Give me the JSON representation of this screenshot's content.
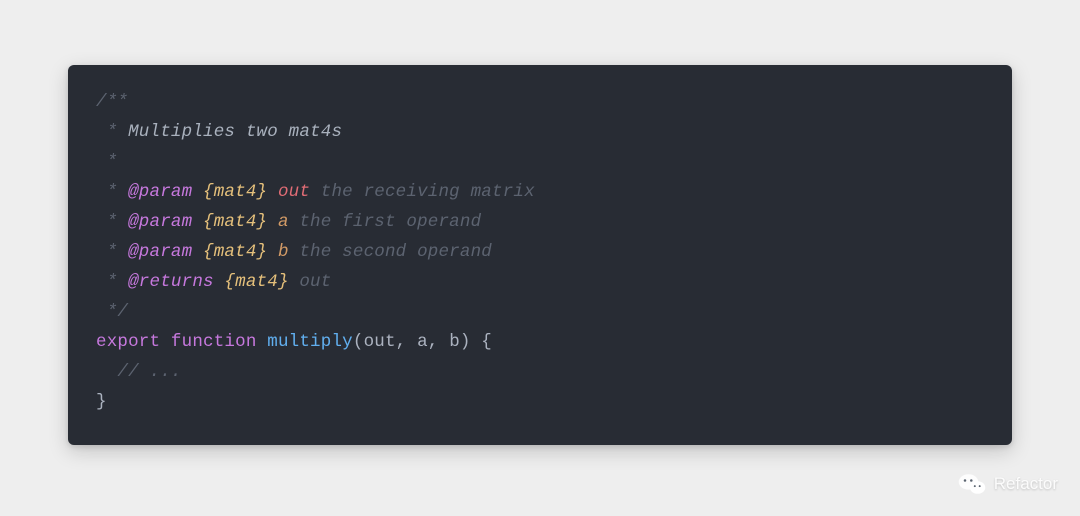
{
  "code": {
    "l1_open": "/**",
    "l2_star": " *",
    "l2_text": " Multiplies two mat4s",
    "l3_star": " *",
    "l4_star": " * ",
    "l4_tag": "@param",
    "l4_type": " {mat4}",
    "l4_name": " out",
    "l4_desc": " the receiving matrix",
    "l5_star": " * ",
    "l5_tag": "@param",
    "l5_type": " {mat4}",
    "l5_name": " a",
    "l5_desc": " the first operand",
    "l6_star": " * ",
    "l6_tag": "@param",
    "l6_type": " {mat4}",
    "l6_name": " b",
    "l6_desc": " the second operand",
    "l7_star": " * ",
    "l7_tag": "@returns",
    "l7_type": " {mat4}",
    "l7_desc": " out",
    "l8_close": " */",
    "l9_kw1": "export",
    "l9_sp": " ",
    "l9_kw2": "function",
    "l9_sp2": " ",
    "l9_fn": "multiply",
    "l9_sig": "(out, a, b) {",
    "l10_body": "  // ...",
    "l11_close": "}"
  },
  "watermark": {
    "label": "Refactor"
  }
}
